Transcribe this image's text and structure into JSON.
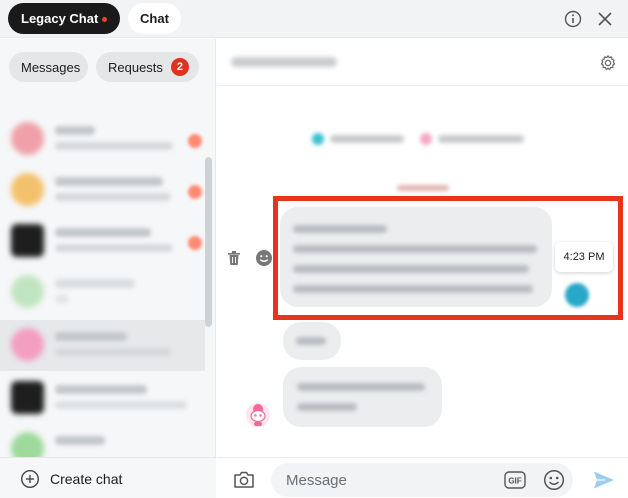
{
  "top_bar": {
    "legacy_tab_label": "Legacy Chat",
    "chat_tab_label": "Chat",
    "info_icon": "info-icon",
    "close_icon": "close-icon"
  },
  "sidebar": {
    "filters": {
      "messages_label": "Messages",
      "requests_label": "Requests",
      "requests_count": "2"
    },
    "conversations_note": "names and previews blurred",
    "conversation_count": 7,
    "selected_index": 4,
    "create_chat_label": "Create chat"
  },
  "main": {
    "header_name_blurred": true,
    "settings_icon": "gear-icon",
    "highlighted_message_time": "4:23 PM",
    "composer": {
      "placeholder": "Message",
      "gif_label": "GIF"
    }
  },
  "colors": {
    "accent_red": "#e8341c",
    "badge_red": "#e0321f",
    "legacy_tab_bg": "#1a1a1b",
    "bubble_bg": "#ebedef",
    "send_blue": "#9ecdf0"
  }
}
